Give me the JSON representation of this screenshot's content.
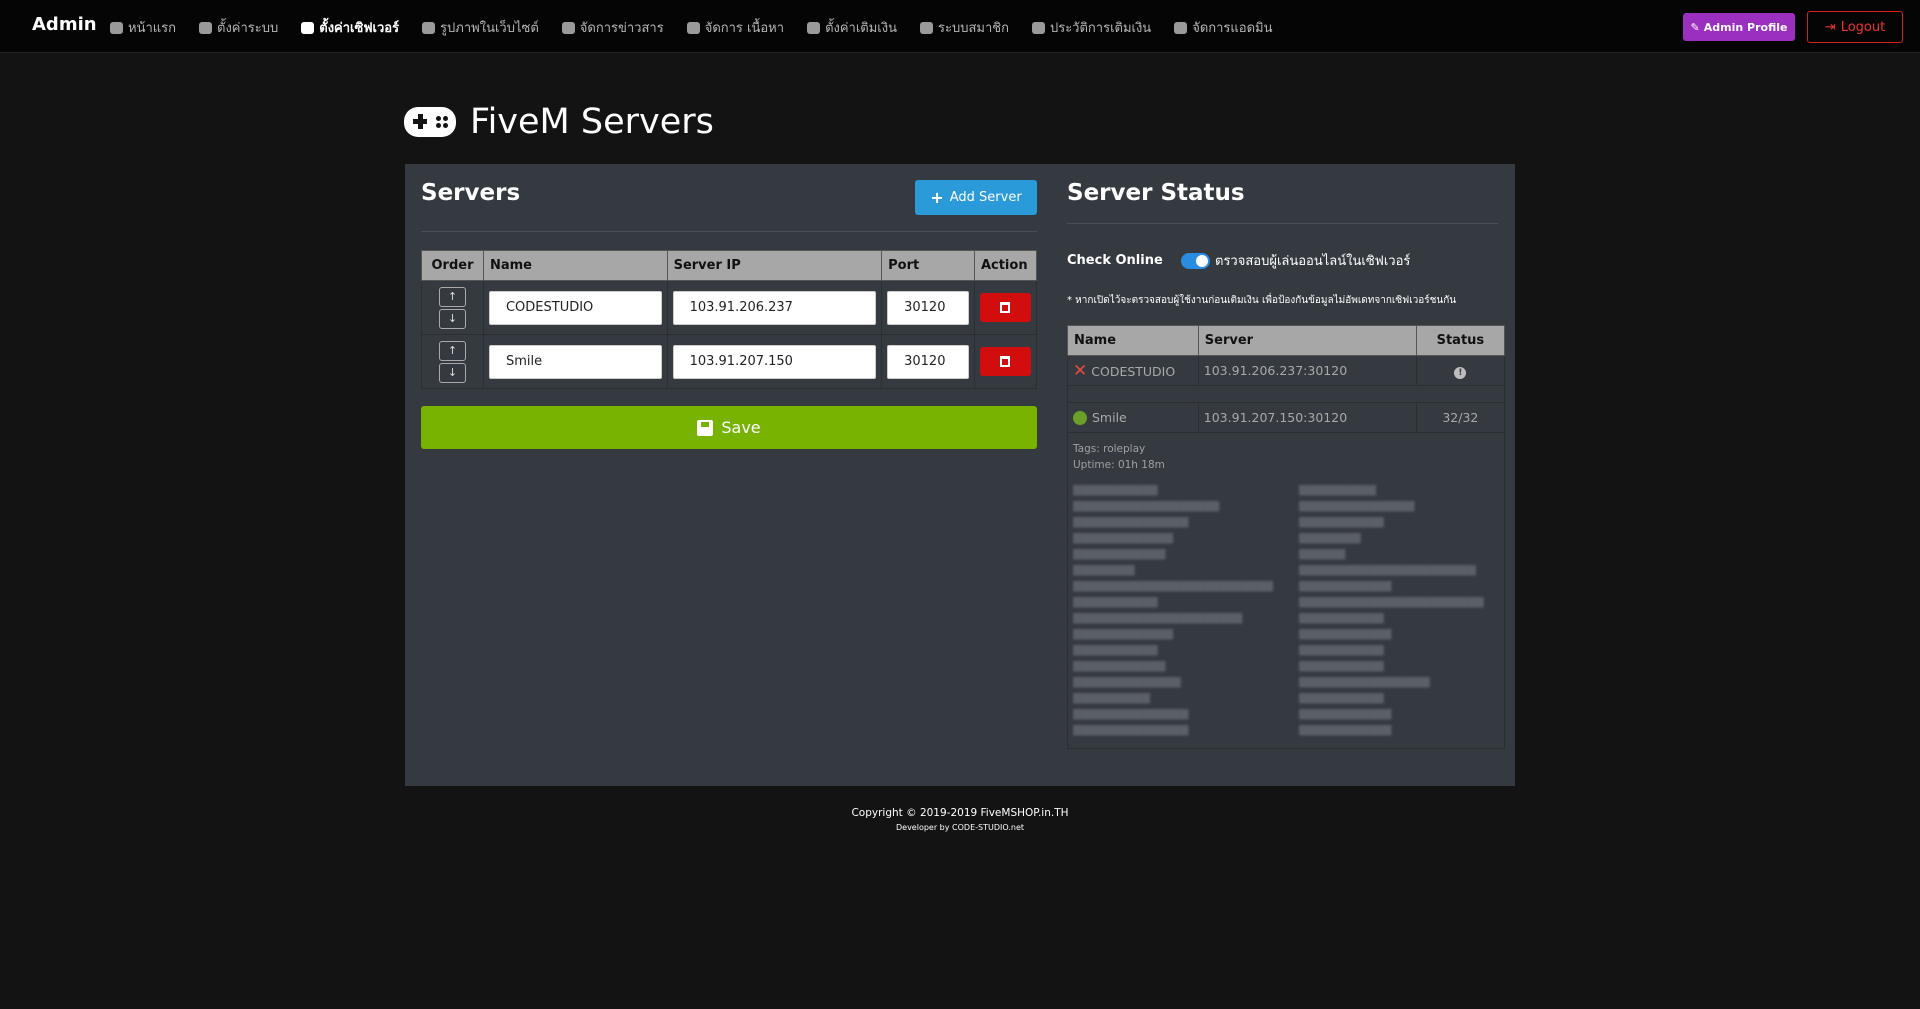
{
  "brand": "Admin",
  "nav": [
    {
      "label": "หน้าแรก",
      "icon": "dashboard-icon",
      "active": false
    },
    {
      "label": "ตั้งค่าระบบ",
      "icon": "cogs-icon",
      "active": false
    },
    {
      "label": "ตั้งค่าเซิฟเวอร์",
      "icon": "gamepad-icon",
      "active": true
    },
    {
      "label": "รูปภาพในเว็บไซต์",
      "icon": "desktop-icon",
      "active": false
    },
    {
      "label": "จัดการข่าวสาร",
      "icon": "newspaper-icon",
      "active": false
    },
    {
      "label": "จัดการ เนื้อหา",
      "icon": "file-icon",
      "active": false
    },
    {
      "label": "ตั้งค่าเติมเงิน",
      "icon": "tools-icon",
      "active": false
    },
    {
      "label": "ระบบสมาชิก",
      "icon": "users-icon",
      "active": false
    },
    {
      "label": "ประวัติการเติมเงิน",
      "icon": "history-icon",
      "active": false
    },
    {
      "label": "จัดการแอดมิน",
      "icon": "user-icon",
      "active": false
    }
  ],
  "header_buttons": {
    "profile": "Admin Profile",
    "logout": "Logout"
  },
  "page_title": "FiveM Servers",
  "servers_panel": {
    "title": "Servers",
    "add_label": "Add Server",
    "columns": [
      "Order",
      "Name",
      "Server IP",
      "Port",
      "Action"
    ],
    "rows": [
      {
        "name": "CODESTUDIO",
        "ip": "103.91.206.237",
        "port": "30120"
      },
      {
        "name": "Smile",
        "ip": "103.91.207.150",
        "port": "30120"
      }
    ],
    "save_label": "Save"
  },
  "status_panel": {
    "title": "Server Status",
    "check_label": "Check Online",
    "check_text": "ตรวจสอบผู้เล่นออนไลน์ในเซิฟเวอร์",
    "check_enabled": true,
    "note": "* หากเปิดไว้จะตรวจสอบผู้ใช้งานก่อนเติมเงิน  เพื่อป้องกันข้อมูลไม่อัพเดทจากเซิฟเวอร์ชนกัน",
    "columns": [
      "Name",
      "Server",
      "Status"
    ],
    "rows": [
      {
        "name": "CODESTUDIO",
        "server": "103.91.206.237:30120",
        "online": false,
        "status": "!"
      },
      {
        "name": "Smile",
        "server": "103.91.207.150:30120",
        "online": true,
        "status": "32/32"
      }
    ],
    "tags": "Tags: roleplay",
    "uptime": "Uptime: 01h 18m"
  },
  "footer": {
    "copyright": "Copyright © 2019-2019 FiveMSHOP.in.TH",
    "developer": "Developer by CODE-STUDIO.net"
  }
}
